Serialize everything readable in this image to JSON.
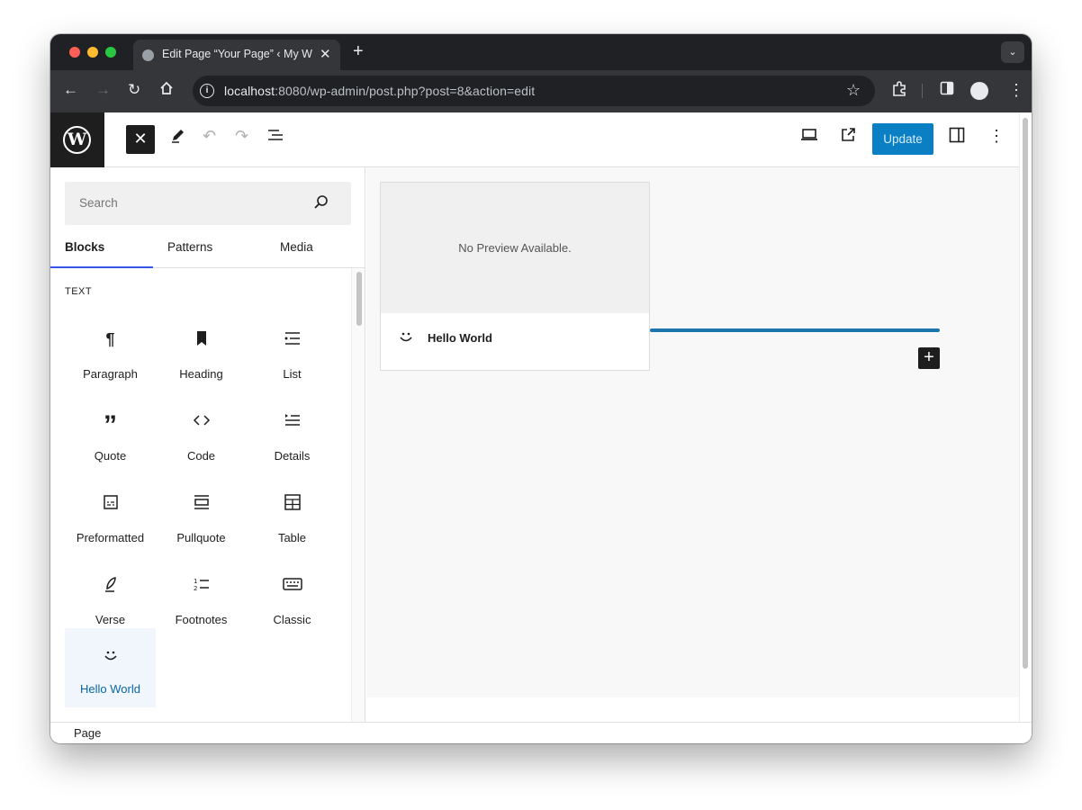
{
  "browser": {
    "tab_title": "Edit Page “Your Page” ‹ My W",
    "tab_close": "✕",
    "new_tab": "+",
    "tab_menu": "⌄",
    "url_host": "localhost",
    "url_rest": ":8080/wp-admin/post.php?post=8&action=edit"
  },
  "editor_header": {
    "close_glyph": "✕",
    "update_label": "Update"
  },
  "inserter": {
    "search_placeholder": "Search",
    "tabs": [
      "Blocks",
      "Patterns",
      "Media"
    ],
    "category": "TEXT",
    "blocks": [
      {
        "label": "Paragraph",
        "icon": "paragraph-icon",
        "glyph": "¶"
      },
      {
        "label": "Heading",
        "icon": "heading-icon",
        "glyph": "■"
      },
      {
        "label": "List",
        "icon": "list-icon",
        "glyph": "☰"
      },
      {
        "label": "Quote",
        "icon": "quote-icon",
        "glyph": "”"
      },
      {
        "label": "Code",
        "icon": "code-icon",
        "glyph": "‹ ›"
      },
      {
        "label": "Details",
        "icon": "details-icon",
        "glyph": "≡"
      },
      {
        "label": "Preformatted",
        "icon": "preformatted-icon",
        "glyph": "▤"
      },
      {
        "label": "Pullquote",
        "icon": "pullquote-icon",
        "glyph": "▭"
      },
      {
        "label": "Table",
        "icon": "table-icon",
        "glyph": "⊞"
      },
      {
        "label": "Verse",
        "icon": "verse-icon",
        "glyph": "✒"
      },
      {
        "label": "Footnotes",
        "icon": "footnotes-icon",
        "glyph": "∶"
      },
      {
        "label": "Classic",
        "icon": "classic-icon",
        "glyph": "⌨"
      },
      {
        "label": "Hello World",
        "icon": "smiley-icon",
        "glyph": "◡"
      }
    ]
  },
  "canvas": {
    "preview_text": "No Preview Available.",
    "block_name": "Hello World",
    "add_glyph": "+"
  },
  "footer": {
    "breadcrumb": "Page"
  },
  "colors": {
    "accent": "#0a7fc4",
    "insertion_line": "#1c75ad",
    "tab_underline": "#3858e9"
  }
}
